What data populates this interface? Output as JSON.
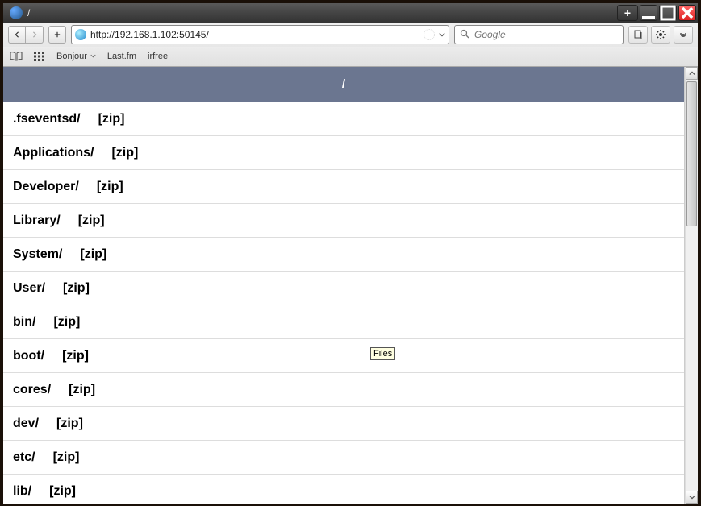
{
  "titlebar": {
    "title": "/"
  },
  "url": "http://192.168.1.102:50145/",
  "search": {
    "placeholder": "Google"
  },
  "bookmarks": {
    "bonjour": "Bonjour",
    "lastfm": "Last.fm",
    "irfree": "irfree"
  },
  "page": {
    "header": "/",
    "zip_label": "[zip]",
    "items": [
      ".fseventsd/",
      "Applications/",
      "Developer/",
      "Library/",
      "System/",
      "User/",
      "bin/",
      "boot/",
      "cores/",
      "dev/",
      "etc/",
      "lib/"
    ]
  },
  "tooltip": "Files"
}
